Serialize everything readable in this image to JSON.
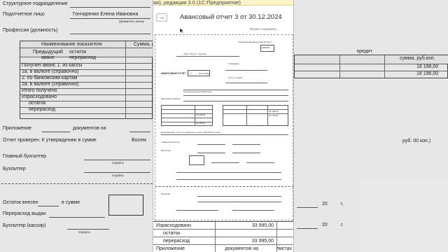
{
  "window": {
    "title_fragment": "ая), редакция 3.0  (1С:Предприятие)",
    "document_title": "Авансовый отчет 3 от 30.12.2024",
    "back_label": "→",
    "print_label": "Печать  Сохранить"
  },
  "background_left": {
    "rows": [
      {
        "label": "Структурное подразделение",
        "value": ""
      },
      {
        "label": "Подотчетное лицо",
        "value": "Гончаренко Елена Ивановна"
      },
      {
        "label": "(фамилия, иници",
        "value": ""
      },
      {
        "label": "Профессия (должность)",
        "value": ""
      }
    ],
    "table": {
      "header": [
        "Наименование показателя",
        "Сумма, р"
      ],
      "rows": [
        {
          "label": "Предыдущий",
          "sub": "остаток"
        },
        {
          "label": "аванс",
          "sub": "перерасход"
        },
        {
          "label": "Получен аванс 1. из кассы",
          "sub": ""
        },
        {
          "label": "1а. в валюте (справочно)",
          "sub": ""
        },
        {
          "label": "2. по банковским картам",
          "sub": ""
        },
        {
          "label": "2а. в валюте (справочно)",
          "sub": ""
        },
        {
          "label": "Итого получено",
          "sub": ""
        },
        {
          "label": "Израсходовано",
          "sub": ""
        },
        {
          "label": "остаток",
          "sub": ""
        },
        {
          "label": "перерасход",
          "sub": ""
        }
      ]
    },
    "footer": [
      {
        "label": "Приложение",
        "value": "документов на"
      },
      {
        "label": "Отчет проверен. К утверждению в сумме",
        "value": "Восем"
      },
      {
        "label": "Главный бухгалтер",
        "value": "подпись"
      },
      {
        "label": "Бухгалтер",
        "value": "подпись"
      },
      {
        "label": "Остаток внесен",
        "value": "в сумме"
      },
      {
        "label": "Перерасход выдан",
        "value": ""
      },
      {
        "label": "Бухгалтер (кассир)",
        "value": "подпись"
      }
    ]
  },
  "background_right": {
    "header": [
      "кредит",
      "сумма, руб.коп."
    ],
    "amounts": [
      "18 198,00",
      "18 196,00"
    ],
    "text": "руб. 00 коп.)",
    "footer_year": "20",
    "footer_suffix": "г."
  },
  "report": {
    "code_line": "Унифицированная форма № АО-1",
    "okud": "0302001",
    "org": "ООО \"Чистое\" торговля",
    "title": "АВАНСОВЫЙ ОТЧЕТ",
    "number": "3",
    "date": "30.12.2024",
    "approve": "Утверждаю",
    "sum_label": "Отчет в сумме",
    "person": "Гончаренко Елена Ивановна",
    "purpose": "Назначение аванса",
    "table_values": [
      "18 198,00",
      "33 995,00",
      "15 795,00"
    ],
    "words_line": "Восемнадцать тысяч сто девяносто шесть рублей 00 копеек",
    "signatures": [
      "Главный бухгалтер",
      "Бухгалтер",
      "Расписка"
    ]
  },
  "bottom_table": {
    "rows": [
      {
        "label": "Израсходовано",
        "value": "33 995,00"
      },
      {
        "label": "остаток",
        "value": ""
      },
      {
        "label": "перерасход",
        "value": "33 995,00"
      },
      {
        "label": "Приложение",
        "value": "документов на"
      }
    ],
    "tail": "листах"
  }
}
